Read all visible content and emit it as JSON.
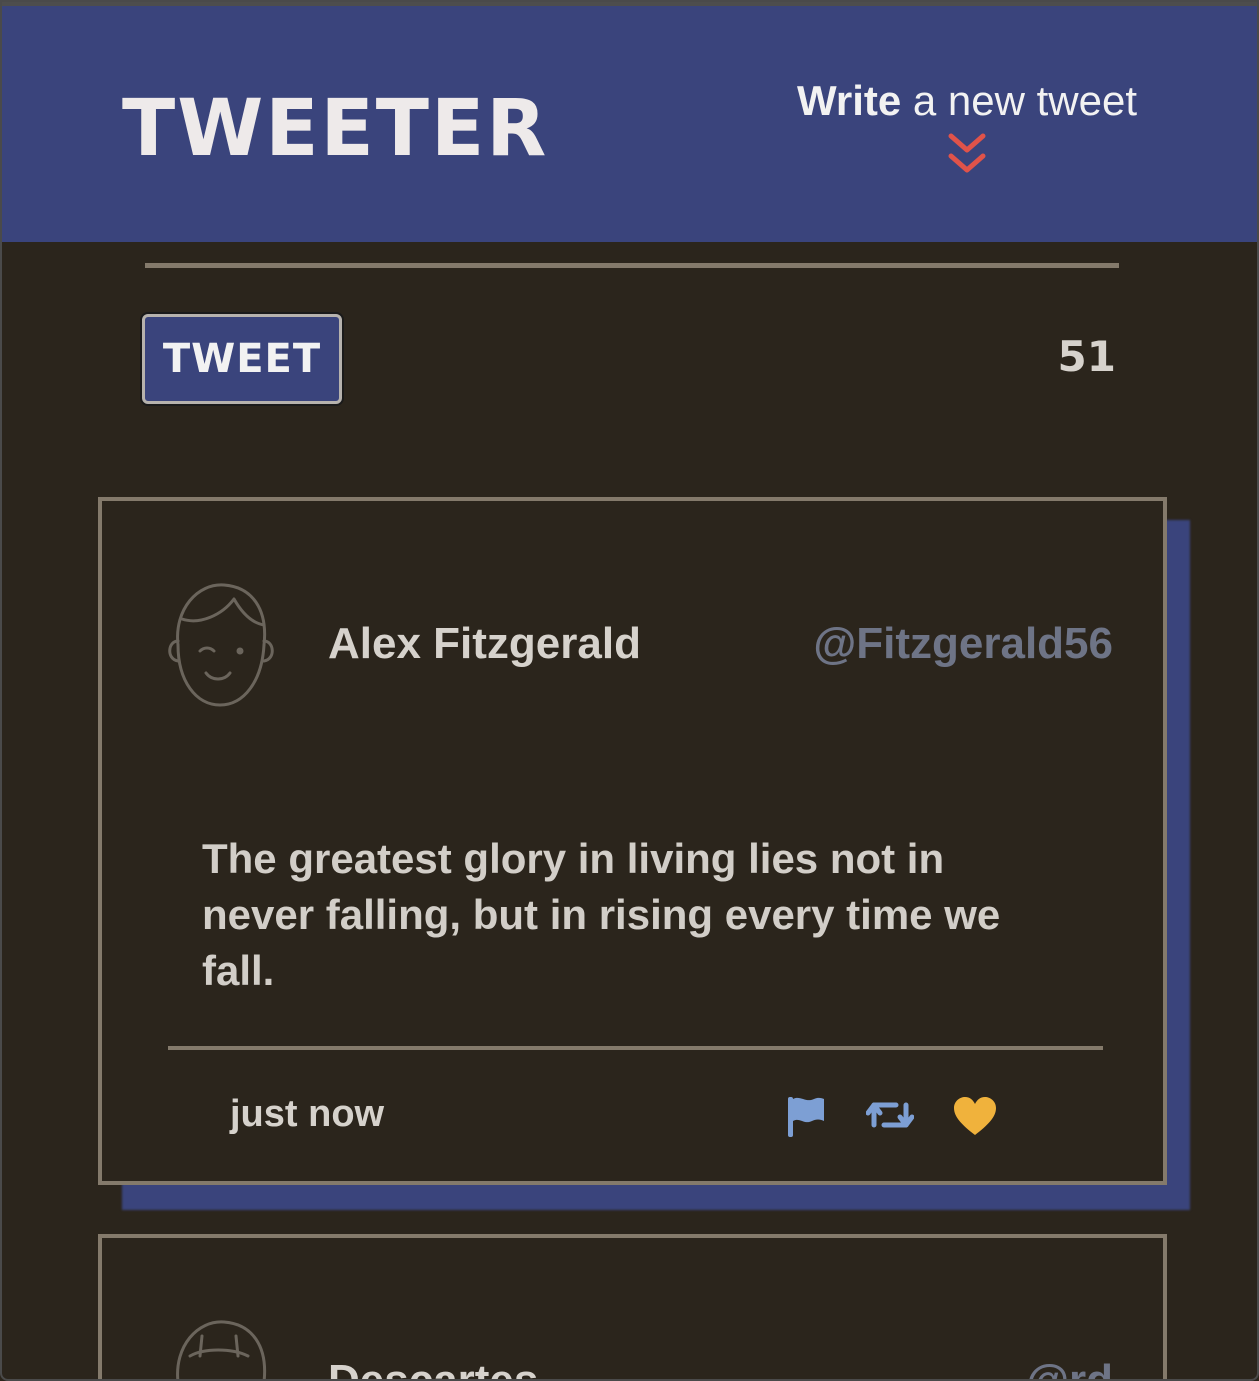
{
  "header": {
    "brand": "TWEETER",
    "compose_bold": "Write",
    "compose_rest": " a new tweet",
    "chevron_icon": "double-chevron-down-icon",
    "chevron_color": "#e0534a"
  },
  "composer": {
    "submit_label": "TWEET",
    "char_counter": "51"
  },
  "tweets": [
    {
      "name": "Alex Fitzgerald",
      "handle": "@Fitzgerald56",
      "text": "The greatest glory in living lies not in never falling, but in rising every time we fall.",
      "time": "just now",
      "actions": {
        "flag_icon": "flag-icon",
        "retweet_icon": "retweet-icon",
        "like_icon": "heart-icon",
        "flag_color": "#7d9fd4",
        "retweet_color": "#7d9fd4",
        "like_color": "#f0b23c"
      }
    },
    {
      "name": "Descartes",
      "handle": "@rd"
    }
  ],
  "colors": {
    "nav_bg": "#3a447c",
    "page_bg": "#2b251c",
    "border": "#847a6b"
  }
}
